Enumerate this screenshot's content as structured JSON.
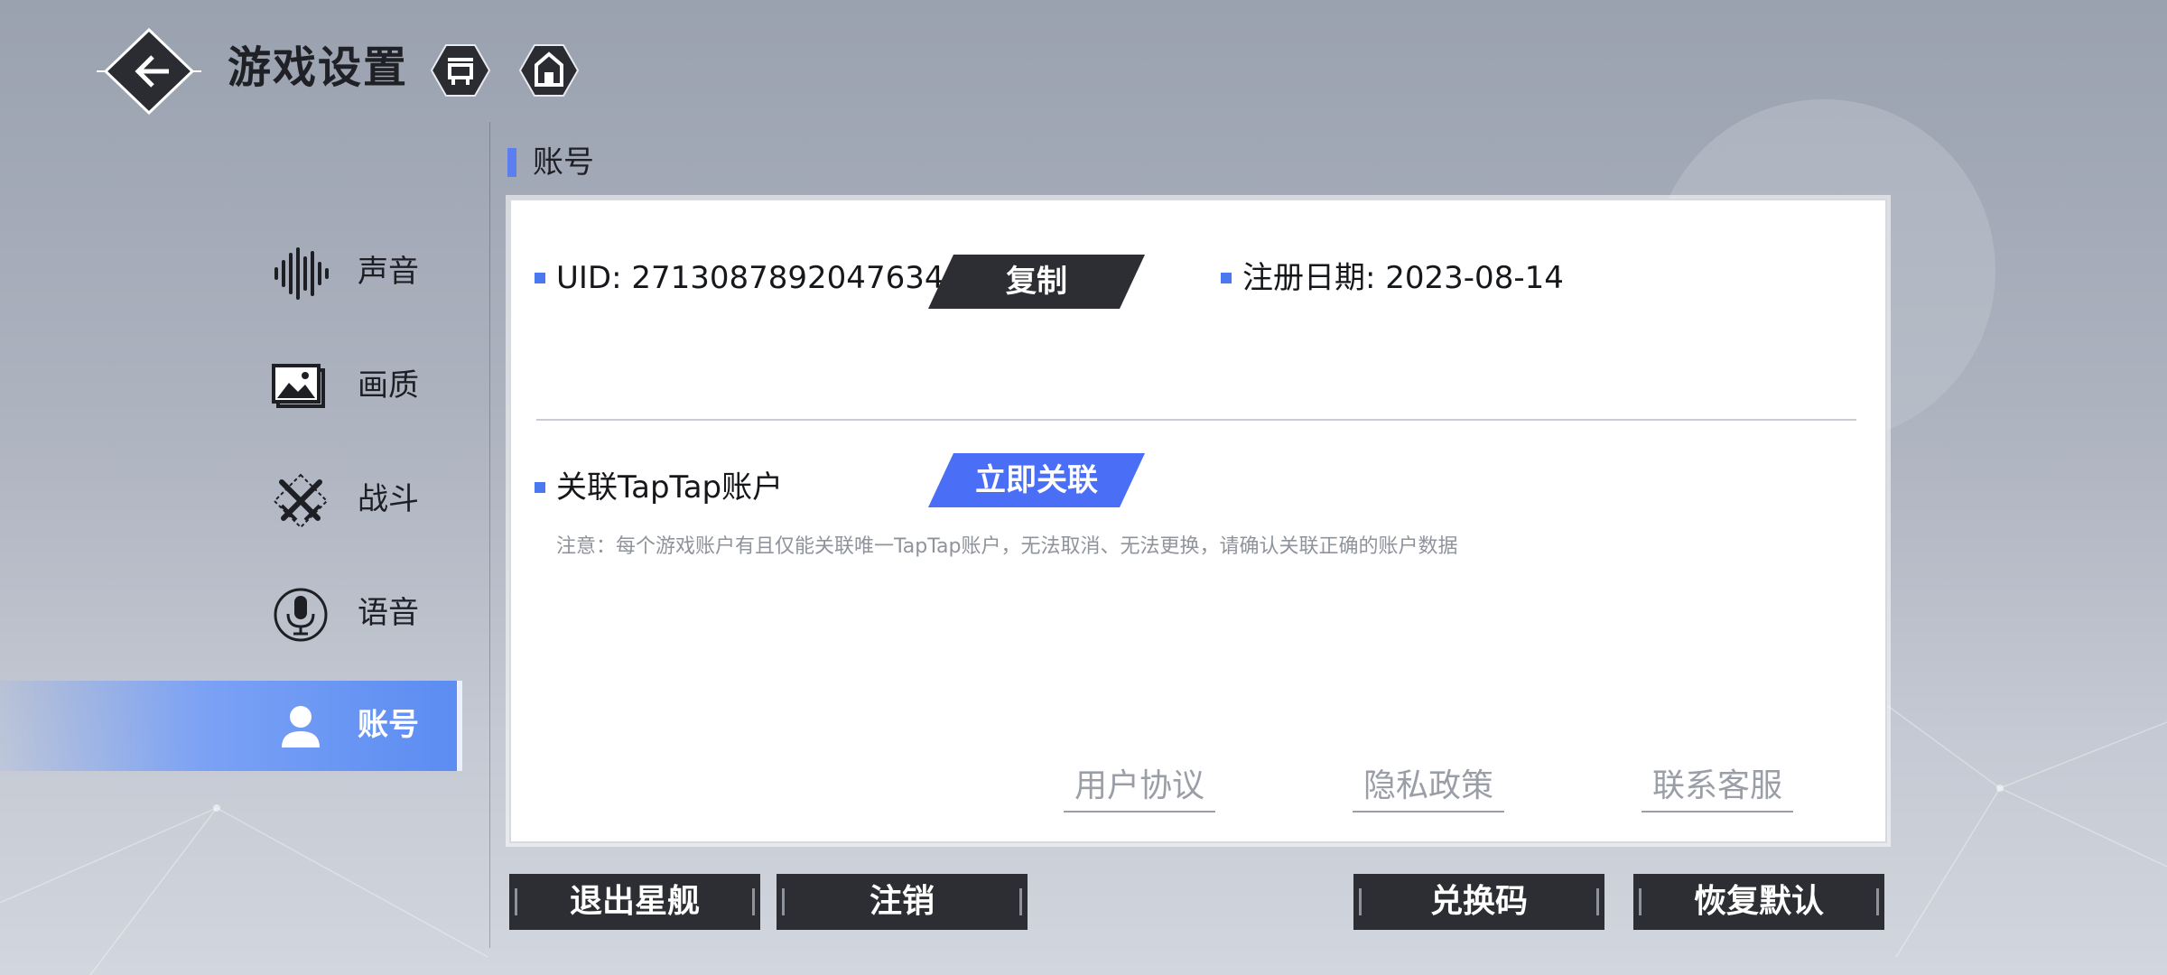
{
  "header": {
    "title": "游戏设置",
    "back_icon": "back-arrow-icon",
    "icons": [
      "settings-gate-icon",
      "home-icon"
    ]
  },
  "sidebar": {
    "items": [
      {
        "label": "声音",
        "icon": "sound-wave-icon",
        "active": false
      },
      {
        "label": "画质",
        "icon": "image-quality-icon",
        "active": false
      },
      {
        "label": "战斗",
        "icon": "crossed-swords-icon",
        "active": false
      },
      {
        "label": "语音",
        "icon": "microphone-icon",
        "active": false
      },
      {
        "label": "账号",
        "icon": "user-icon",
        "active": true
      }
    ]
  },
  "section": {
    "title": "账号"
  },
  "account": {
    "uid_label": "UID: ",
    "uid_value": "27130878920476348",
    "copy_button": "复制",
    "register_label": "注册日期: ",
    "register_date": "2023-08-14",
    "taptap_label": "关联TapTap账户",
    "link_button": "立即关联",
    "note": "注意：每个游戏账户有且仅能关联唯一TapTap账户，无法取消、无法更换，请确认关联正确的账户数据"
  },
  "links": [
    "用户协议",
    "隐私政策",
    "联系客服"
  ],
  "bottom_buttons": {
    "left": [
      "退出星舰",
      "注销"
    ],
    "right": [
      "兑换码",
      "恢复默认"
    ]
  },
  "colors": {
    "accent": "#4a6ef5",
    "dark_button": "#2c2e33",
    "sidebar_active": "#5b8cf2"
  }
}
